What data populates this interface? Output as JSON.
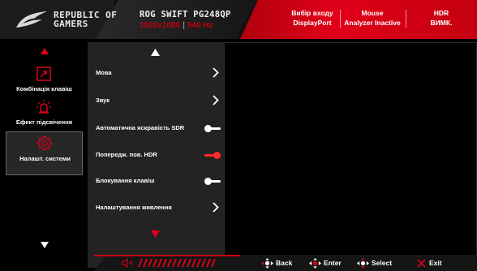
{
  "header": {
    "brand_line1": "REPUBLIC OF",
    "brand_line2": "GAMERS",
    "model": "ROG SWIFT PG248QP",
    "resolution": "1920x1080",
    "refresh": "540 Hz",
    "input_label": "Вибір входу",
    "input_value": "DisplayPort",
    "mouse_label": "Mouse",
    "mouse_value": "Analyzer Inactive",
    "hdr_label": "HDR",
    "hdr_value": "ВИМК."
  },
  "sidebar": {
    "items": [
      {
        "label": "Комбінація клавіш",
        "icon": "shortcut-icon"
      },
      {
        "label": "Ефект підсвічення",
        "icon": "light-effect-icon"
      },
      {
        "label": "Налашт. системи",
        "icon": "system-settings-gear-icon",
        "active": true
      }
    ]
  },
  "menu": {
    "items": [
      {
        "label": "Мова",
        "control": "submenu"
      },
      {
        "label": "Звук",
        "control": "submenu"
      },
      {
        "label": "Автоматична яскравість SDR",
        "control": "toggle",
        "state": "off"
      },
      {
        "label": "Попередж. пов. HDR",
        "control": "toggle",
        "state": "on"
      },
      {
        "label": "Блокування клавіш",
        "control": "toggle",
        "state": "off"
      },
      {
        "label": "Налаштування живлення",
        "control": "submenu"
      }
    ]
  },
  "footer": {
    "back": "Back",
    "enter": "Enter",
    "select": "Select",
    "exit": "Exit"
  },
  "colors": {
    "accent_red": "#e0001a",
    "toggle_on": "#ff2a2a",
    "toggle_off": "#ffffff"
  }
}
